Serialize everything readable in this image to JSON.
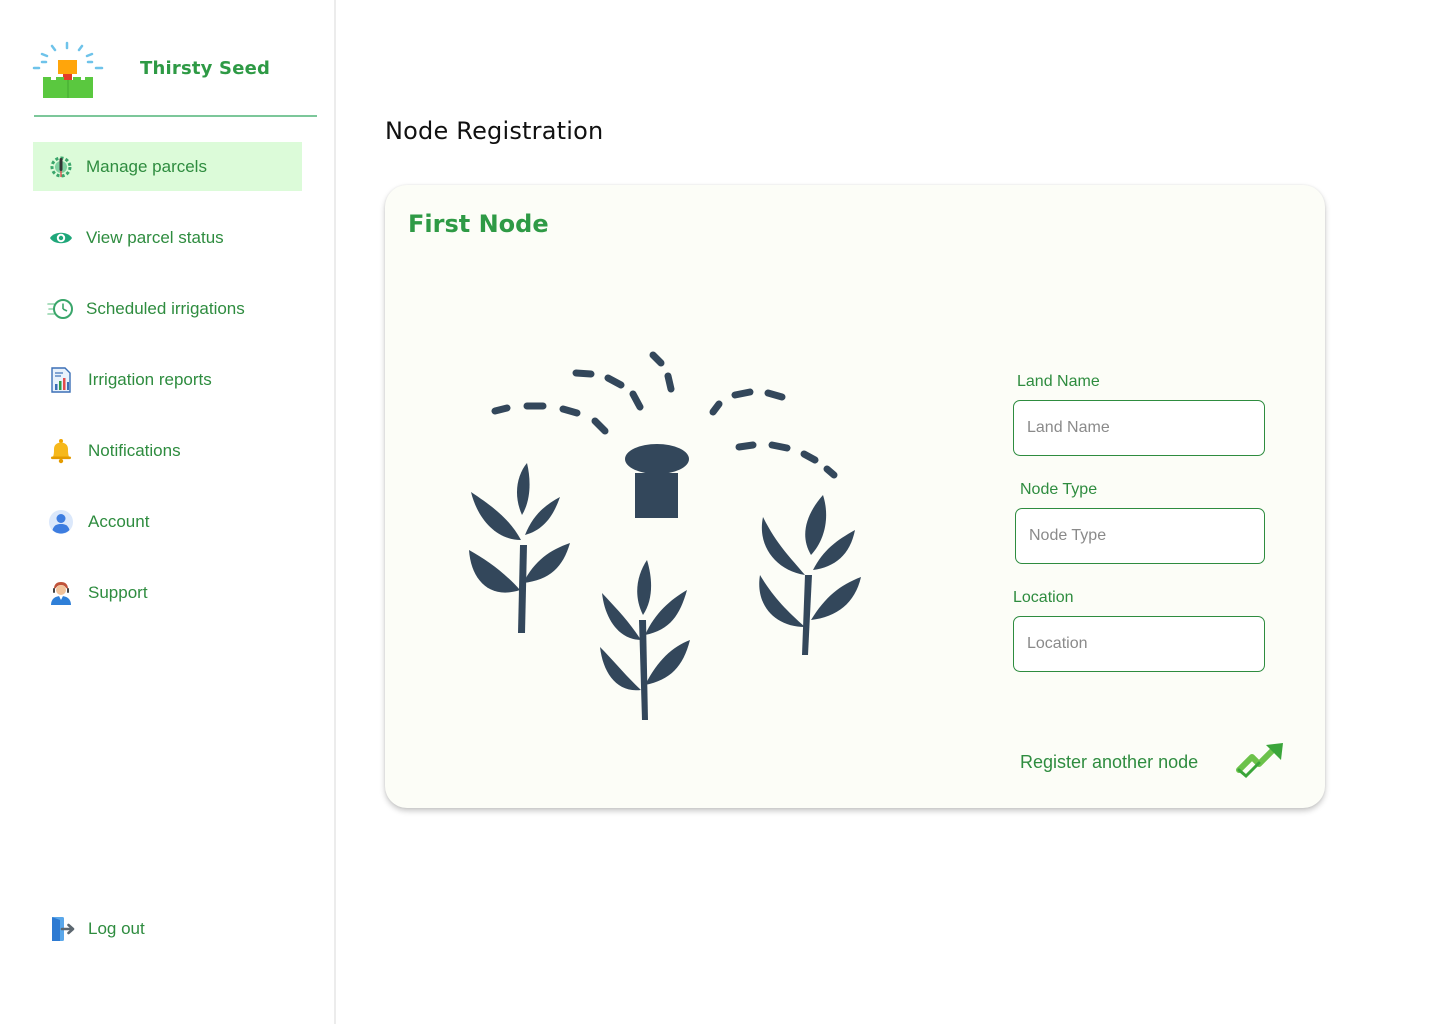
{
  "brand": {
    "name": "Thirsty Seed",
    "logo_icon": "sprinkler-logo-icon"
  },
  "sidebar": {
    "items": [
      {
        "label": "Manage parcels",
        "icon": "parcel-gear-icon",
        "active": true
      },
      {
        "label": "View parcel status",
        "icon": "eye-icon",
        "active": false
      },
      {
        "label": "Scheduled irrigations",
        "icon": "clock-icon",
        "active": false
      },
      {
        "label": "Irrigation reports",
        "icon": "report-chart-icon",
        "active": false
      },
      {
        "label": "Notifications",
        "icon": "bell-icon",
        "active": false
      },
      {
        "label": "Account",
        "icon": "user-icon",
        "active": false
      },
      {
        "label": "Support",
        "icon": "support-agent-icon",
        "active": false
      }
    ],
    "logout_label": "Log out",
    "logout_icon": "logout-icon"
  },
  "main": {
    "page_title": "Node Registration",
    "card": {
      "title": "First Node",
      "illustration_icon": "sprinkler-plants-icon",
      "fields": [
        {
          "label": "Land Name",
          "placeholder": "Land Name",
          "value": ""
        },
        {
          "label": "Node Type",
          "placeholder": "Node Type",
          "value": ""
        },
        {
          "label": "Location",
          "placeholder": "Location",
          "value": ""
        }
      ],
      "register_label": "Register another node",
      "register_icon": "trending-up-arrow-icon"
    }
  },
  "colors": {
    "accent_green": "#2e8c3f",
    "brand_green": "#2e9a45",
    "active_nav_bg": "#dcfbd9",
    "card_bg": "#fcfdf7",
    "illustration": "#33475b"
  }
}
